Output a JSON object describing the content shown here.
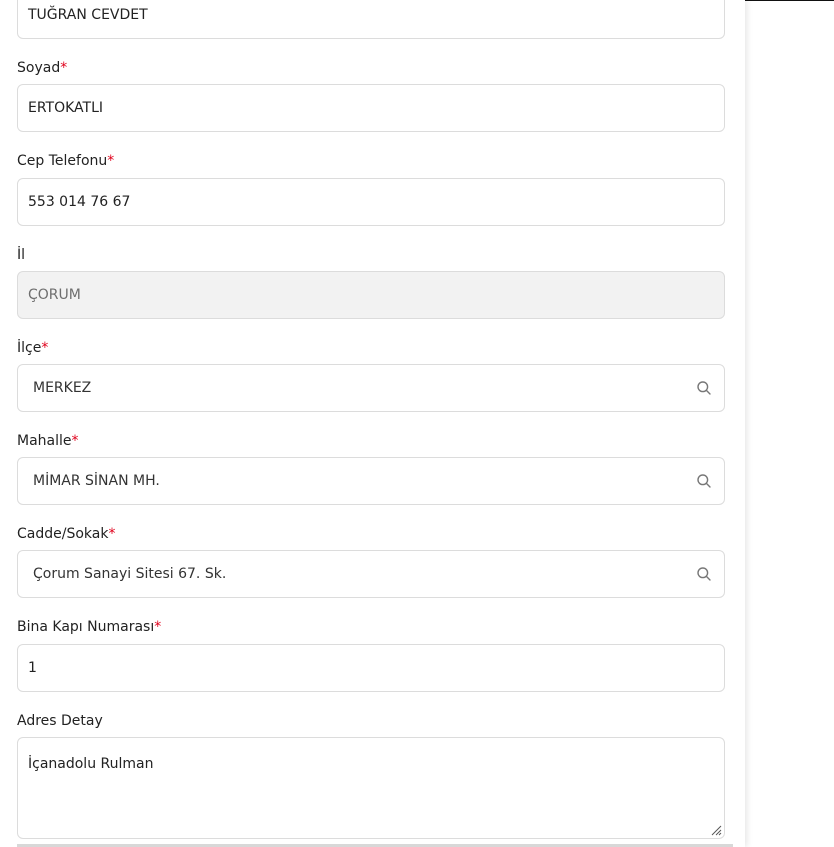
{
  "form": {
    "ad_value": "TUĞRAN CEVDET",
    "soyad": {
      "label": "Soyad",
      "required": "*",
      "value": "ERTOKATLI"
    },
    "cep_telefonu": {
      "label": "Cep Telefonu",
      "required": "*",
      "value": "553 014 76 67"
    },
    "il": {
      "label": "İl",
      "value": "ÇORUM"
    },
    "ilce": {
      "label": "İlçe",
      "required": "*",
      "value": "MERKEZ"
    },
    "mahalle": {
      "label": "Mahalle",
      "required": "*",
      "value": "MİMAR SİNAN MH."
    },
    "cadde_sokak": {
      "label": "Cadde/Sokak",
      "required": "*",
      "value": "Çorum Sanayi Sitesi 67. Sk."
    },
    "bina_kapi": {
      "label": "Bina Kapı Numarası",
      "required": "*",
      "value": "1"
    },
    "adres_detay": {
      "label": "Adres Detay",
      "value": "İçanadolu Rulman"
    }
  },
  "colors": {
    "required": "#e0001b",
    "border": "#dcdcdc",
    "disabled_bg": "#f2f2f2"
  },
  "icons": {
    "search": "search-icon",
    "resize": "resize-grip-icon"
  }
}
